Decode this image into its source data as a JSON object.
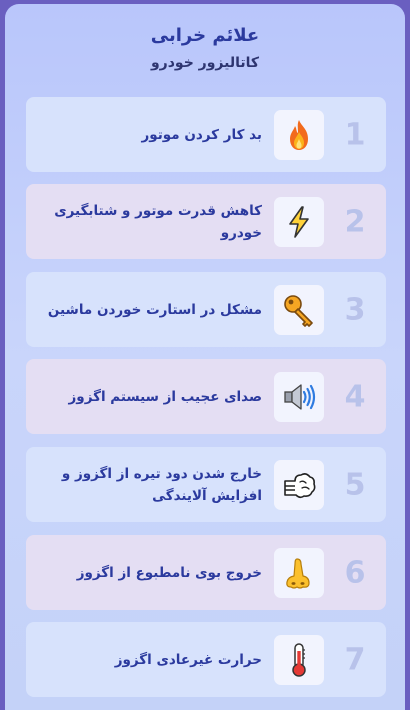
{
  "header": {
    "title": "علائم خرابی",
    "subtitle": "کاتالیزور خودرو"
  },
  "symptoms": [
    {
      "number": "1",
      "icon": "fire-icon",
      "label": "بد کار کردن موتور"
    },
    {
      "number": "2",
      "icon": "lightning-icon",
      "label": "کاهش قدرت موتور و شتابگیری خودرو"
    },
    {
      "number": "3",
      "icon": "key-icon",
      "label": "مشکل در استارت خوردن ماشین"
    },
    {
      "number": "4",
      "icon": "speaker-icon",
      "label": "صدای عجیب از سیستم اگزوز"
    },
    {
      "number": "5",
      "icon": "smoke-icon",
      "label": "خارج شدن دود تیره از اگزوز و افزایش آلایندگی"
    },
    {
      "number": "6",
      "icon": "nose-icon",
      "label": "خروج بوی نامطبوع از اگزوز"
    },
    {
      "number": "7",
      "icon": "thermometer-icon",
      "label": "حرارت غیرعادی اگزوز"
    }
  ],
  "colors": {
    "background": "#6a5fc0",
    "card": "#c4d0fa",
    "item_blue": "#d7e2fc",
    "item_pink": "#e4def3",
    "title": "#2b3a9e",
    "number": "#b8c2ea"
  }
}
